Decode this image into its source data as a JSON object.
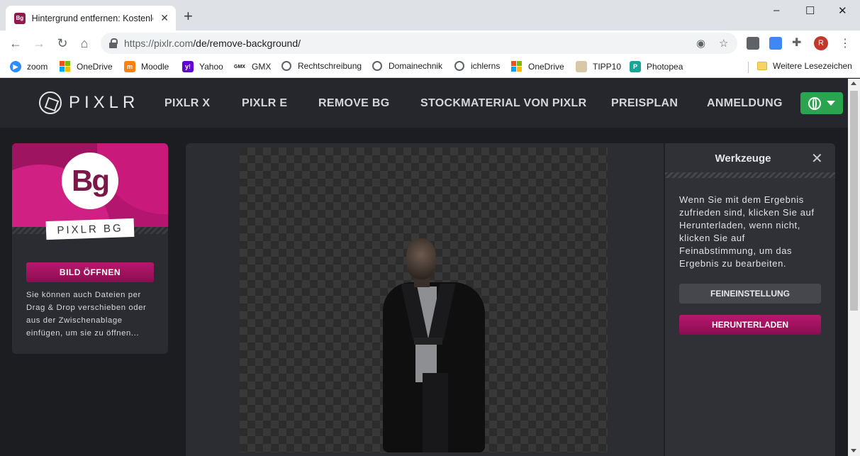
{
  "browser": {
    "tab_title": "Hintergrund entfernen: Kostenlos",
    "tab_favicon": "Bg",
    "url_host": "https://pixlr.com",
    "url_path": "/de/remove-background/",
    "avatar_letter": "R",
    "window_controls": [
      "–",
      "☐",
      "✕"
    ],
    "bookmarks": [
      {
        "label": "zoom",
        "icon": "zoom-icon"
      },
      {
        "label": "OneDrive",
        "icon": "microsoft-icon"
      },
      {
        "label": "Moodle",
        "icon": "moodle-icon"
      },
      {
        "label": "Yahoo",
        "icon": "yahoo-icon"
      },
      {
        "label": "GMX",
        "icon": "gmx-icon"
      },
      {
        "label": "Rechtschreibung",
        "icon": "globe-icon"
      },
      {
        "label": "Domainechnik",
        "icon": "globe-icon"
      },
      {
        "label": "ichlerns",
        "icon": "globe-icon"
      },
      {
        "label": "OneDrive",
        "icon": "microsoft-icon"
      },
      {
        "label": "TIPP10",
        "icon": "tipp10-icon"
      },
      {
        "label": "Photopea",
        "icon": "photopea-icon"
      }
    ],
    "other_bookmarks": "Weitere Lesezeichen"
  },
  "site": {
    "logo_text": "PIXLR",
    "nav": [
      "PIXLR X",
      "PIXLR E",
      "REMOVE BG",
      "STOCKMATERIAL VON PIXLR",
      "PREISPLAN",
      "ANMELDUNG"
    ],
    "accent_color": "#b8176e",
    "lang_color": "#2aa44f"
  },
  "left_card": {
    "badge": "Bg",
    "label": "PIXLR BG",
    "open_button": "BILD ÖFFNEN",
    "help_text": "Sie können auch Dateien per Drag & Drop verschieben oder aus der Zwischenablage einfügen, um sie zu öffnen..."
  },
  "tools_panel": {
    "title": "Werkzeuge",
    "close": "✕",
    "description": "Wenn Sie mit dem Ergebnis zufrieden sind, klicken Sie auf Herunterladen, wenn nicht, klicken Sie auf Feinabstimmung, um das Ergebnis zu bearbeiten.",
    "refine_button": "FEINEINSTELLUNG",
    "download_button": "HERUNTERLADEN"
  }
}
